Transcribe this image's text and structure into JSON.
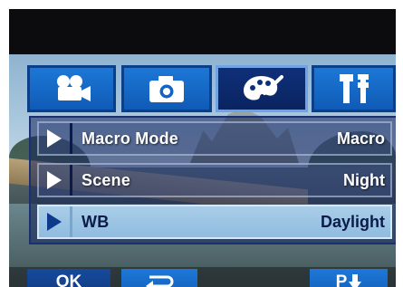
{
  "tabs": [
    {
      "icon": "movie-camera-icon",
      "active": false
    },
    {
      "icon": "photo-camera-icon",
      "active": false
    },
    {
      "icon": "palette-brush-icon",
      "active": true
    },
    {
      "icon": "tools-settings-icon",
      "active": false
    }
  ],
  "menu": {
    "items": [
      {
        "label": "Macro Mode",
        "value": "Macro",
        "selected": false
      },
      {
        "label": "Scene",
        "value": "Night",
        "selected": false
      },
      {
        "label": "WB",
        "value": "Daylight",
        "selected": true
      }
    ]
  },
  "buttons": {
    "ok_label": "OK",
    "return_icon": "return-arrow-icon",
    "page_down_label": "P",
    "page_down_icon": "down-arrow-icon"
  },
  "colors": {
    "tab_blue": "#1d77d6",
    "tab_active": "#0f2f7a",
    "row_selected": "#a9cde8",
    "panel": "#12225a"
  }
}
